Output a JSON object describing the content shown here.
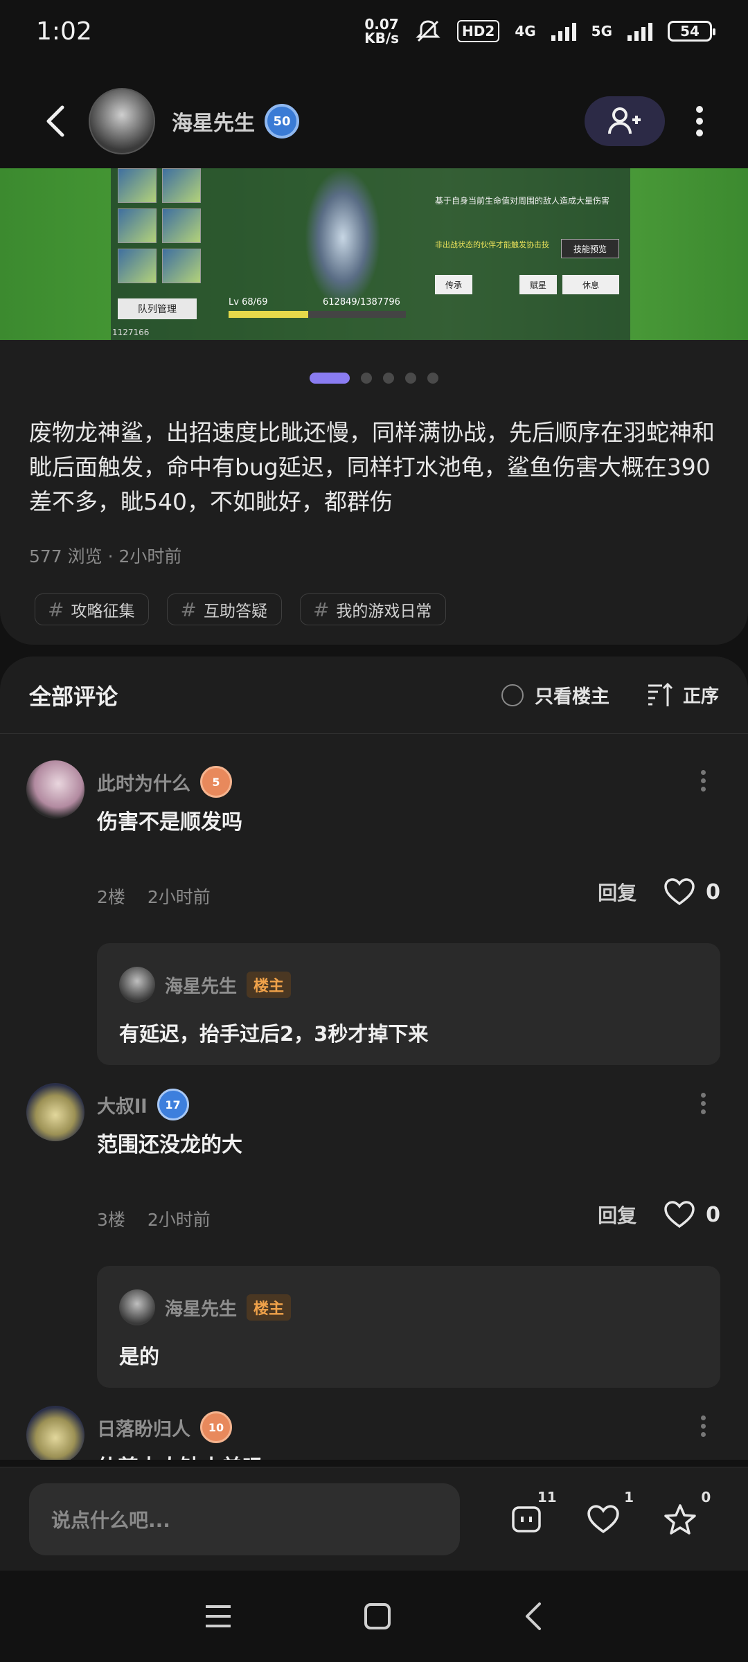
{
  "status": {
    "time": "1:02",
    "net_speed_value": "0.07",
    "net_speed_unit": "KB/s",
    "hd_label": "HD2",
    "sig1": "4G",
    "sig2": "5G",
    "battery": "54"
  },
  "header": {
    "author": "海星先生",
    "author_level": "50"
  },
  "banner": {
    "queue_btn": "队列管理",
    "id_text": "1127166",
    "level_text": "Lv 68/69",
    "xp_text": "612849/1387796",
    "desc": "基于自身当前生命值对周围的敌人造成大量伤害",
    "desc2": "非出战状态的伙伴才能触发协击技",
    "skill_btn": "技能预览",
    "btn1": "传承",
    "btn2": "赋星",
    "btn3": "休息"
  },
  "carousel": {
    "total": 5,
    "active_index": 0
  },
  "post": {
    "text": "废物龙神鲨，出招速度比眦还慢，同样满协战，先后顺序在羽蛇神和眦后面触发，命中有bug延迟，同样打水池龟，鲨鱼伤害大概在390差不多，眦540，不如眦好，都群伤",
    "meta": "577 浏览 · 2小时前",
    "tags": [
      "攻略征集",
      "互助答疑",
      "我的游戏日常"
    ]
  },
  "comments_section": {
    "title": "全部评论",
    "only_op_label": "只看楼主",
    "sort_label": "正序",
    "items": [
      {
        "user": "此时为什么",
        "level": "5",
        "text": "伤害不是顺发吗",
        "floor": "2楼",
        "time": "2小时前",
        "reply_label": "回复",
        "likes": "0",
        "reply": {
          "user": "海星先生",
          "op_tag": "楼主",
          "text": "有延迟，抬手过后2，3秒才掉下来"
        }
      },
      {
        "user": "大叔ll",
        "level": "17",
        "text": "范围还没龙的大",
        "floor": "3楼",
        "time": "2小时前",
        "reply_label": "回复",
        "likes": "0",
        "reply": {
          "user": "海星先生",
          "op_tag": "楼主",
          "text": "是的"
        }
      },
      {
        "user": "日落盼归人",
        "level": "10",
        "text": "仙尊大人缺小弟吗"
      }
    ]
  },
  "bottom": {
    "input_placeholder": "说点什么吧...",
    "comment_count": "11",
    "like_count": "1",
    "fav_count": "0"
  },
  "colors": {
    "accent": "#8a7cf2",
    "op_tag": "#f0a24a",
    "background": "#121212",
    "card": "#1e1e1e"
  },
  "icons": [
    "back-icon",
    "add-friend-icon",
    "more-icon",
    "radio-icon",
    "sort-icon",
    "heart-icon",
    "comment-icon",
    "star-icon",
    "menu-icon",
    "home-icon",
    "nav-back-icon"
  ]
}
